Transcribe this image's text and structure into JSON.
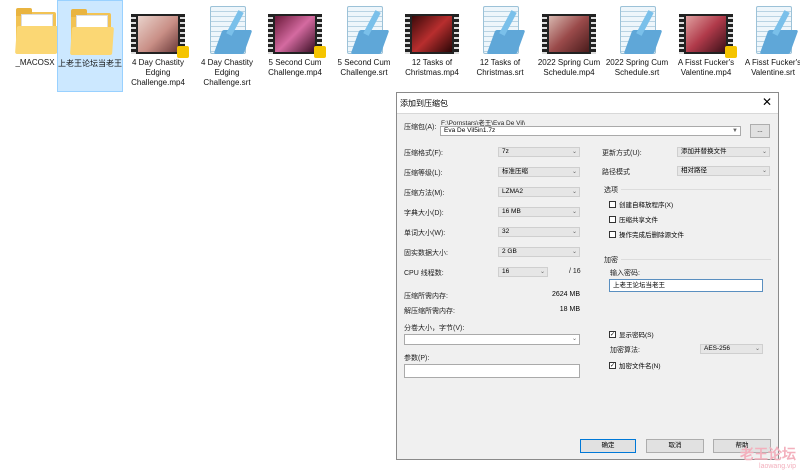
{
  "desktop": {
    "files": [
      {
        "label": "_MACOSX",
        "type": "folder"
      },
      {
        "label": "上老王论坛当老王",
        "type": "folder"
      },
      {
        "label": "4 Day Chastity Edging Challenge.mp4",
        "type": "video"
      },
      {
        "label": "4 Day Chastity Edging Challenge.srt",
        "type": "srt"
      },
      {
        "label": "5 Second Cum Challenge.mp4",
        "type": "video"
      },
      {
        "label": "5 Second Cum Challenge.srt",
        "type": "srt"
      },
      {
        "label": "12 Tasks of Christmas.mp4",
        "type": "video"
      },
      {
        "label": "12 Tasks of Christmas.srt",
        "type": "srt"
      },
      {
        "label": "2022 Spring Cum Schedule.mp4",
        "type": "video"
      },
      {
        "label": "2022 Spring Cum Schedule.srt",
        "type": "srt"
      },
      {
        "label": "A Fisst Fucker's Valentine.mp4",
        "type": "video"
      },
      {
        "label": "A Fisst Fucker's Valentine.srt",
        "type": "srt"
      }
    ]
  },
  "dialog": {
    "title": "添加到压缩包",
    "archive_label": "压缩包(A):",
    "archive_path": "F:\\Pornstars\\老王\\Eva De Vil\\",
    "archive_name": "Eva De Vil5in1.7z",
    "browse_button": "...",
    "format_label": "压缩格式(F):",
    "format_value": "7z",
    "level_label": "压缩等级(L):",
    "level_value": "标准压缩",
    "method_label": "压缩方法(M):",
    "method_value": "LZMA2",
    "dict_label": "字典大小(D):",
    "dict_value": "16 MB",
    "word_label": "单词大小(W):",
    "word_value": "32",
    "solid_label": "固实数据大小:",
    "solid_value": "2 GB",
    "cpu_label": "CPU 线程数:",
    "cpu_value": "16",
    "cpu_total": "/ 16",
    "mem_comp_label": "压缩所需内存:",
    "mem_comp_value": "2624 MB",
    "mem_decomp_label": "解压缩所需内存:",
    "mem_decomp_value": "18 MB",
    "split_label": "分卷大小，字节(V):",
    "split_value": "",
    "params_label": "参数(P):",
    "params_value": "",
    "update_label": "更新方式(U):",
    "update_value": "添加并替换文件",
    "path_label": "路径模式",
    "path_value": "相对路径",
    "options_title": "选项",
    "opt_sfx": "创建自释放程序(X)",
    "opt_shared": "压缩共享文件",
    "opt_delete": "操作完成后删除源文件",
    "enc_title": "加密",
    "pwd_label": "输入密码:",
    "pwd_value": "上老王论坛当老王",
    "show_pwd": "显示密码(S)",
    "enc_method_label": "加密算法:",
    "enc_method_value": "AES-256",
    "enc_names": "加密文件名(N)",
    "ok": "确定",
    "cancel": "取消",
    "help": "帮助"
  },
  "watermark": {
    "line1": "老王论坛",
    "line2": "laowang.vip"
  }
}
